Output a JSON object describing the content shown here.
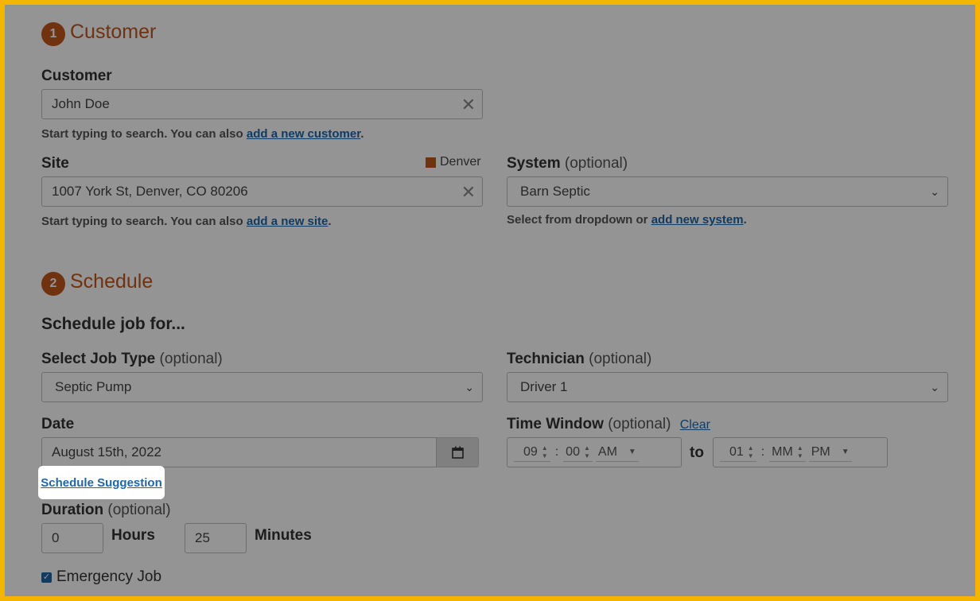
{
  "customer_section": {
    "step": "1",
    "title": "Customer",
    "customer_label": "Customer",
    "customer_value": "John Doe",
    "customer_help_prefix": "Start typing to search. You can also",
    "customer_help_link": "add a new customer",
    "site_label": "Site",
    "site_region": "Denver",
    "site_value": "1007 York St, Denver, CO 80206",
    "site_help_prefix": "Start typing to search. You can also",
    "site_help_link": "add a new site",
    "system_label": "System",
    "system_optional": "(optional)",
    "system_value": "Barn Septic",
    "system_help_prefix": "Select from dropdown or",
    "system_help_link": "add new system"
  },
  "schedule_section": {
    "step": "2",
    "title": "Schedule",
    "subtitle": "Schedule job for...",
    "job_type_label": "Select Job Type",
    "job_type_optional": "(optional)",
    "job_type_value": "Septic Pump",
    "technician_label": "Technician",
    "technician_optional": "(optional)",
    "technician_value": "Driver 1",
    "date_label": "Date",
    "date_value": "August 15th, 2022",
    "time_window_label": "Time Window",
    "time_window_optional": "(optional)",
    "time_window_clear": "Clear",
    "start_hour": "09",
    "start_minute": "00",
    "start_ampm": "AM",
    "to_label": "to",
    "end_hour": "01",
    "end_minute": "MM",
    "end_ampm": "PM",
    "schedule_suggestion": "Schedule Suggestion",
    "duration_label": "Duration",
    "duration_optional": "(optional)",
    "hours_value": "0",
    "hours_label": "Hours",
    "minutes_value": "25",
    "minutes_label": "Minutes",
    "emergency_label": "Emergency Job"
  },
  "colors": {
    "accent": "#c2561a",
    "link": "#1f66a8",
    "frame": "#f5b400",
    "region_marker": "#c2561a"
  }
}
